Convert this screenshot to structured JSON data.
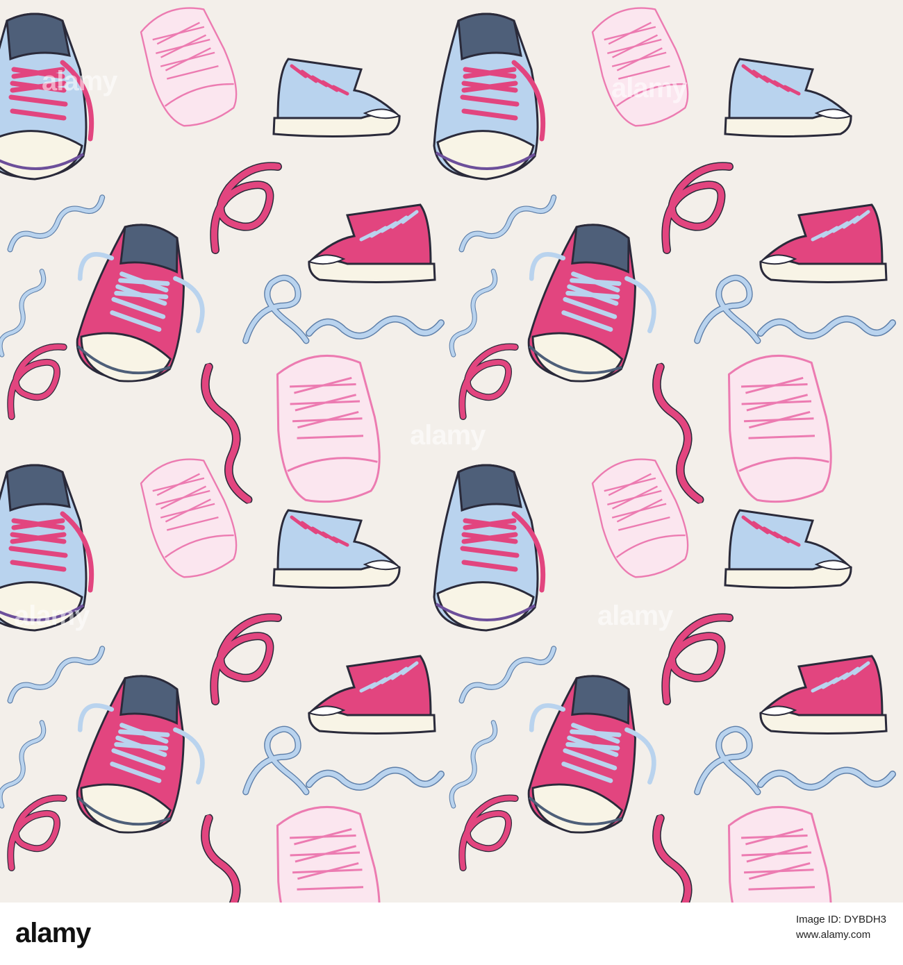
{
  "colors": {
    "background": "#f3efea",
    "pink": "#e2457f",
    "pink_dark": "#b32c5f",
    "light_blue": "#b9d3ee",
    "light_blue_dark": "#8fb1d8",
    "navy": "#4e5f79",
    "outline_pink": "#ec7bb1",
    "sole": "#f8f4e6",
    "ink": "#2a2a3a"
  },
  "watermark": {
    "text": "alamy"
  },
  "footer": {
    "logo": "alamy",
    "image_id_line": "Image ID: DYBDH3",
    "url_line": "www.alamy.com"
  }
}
